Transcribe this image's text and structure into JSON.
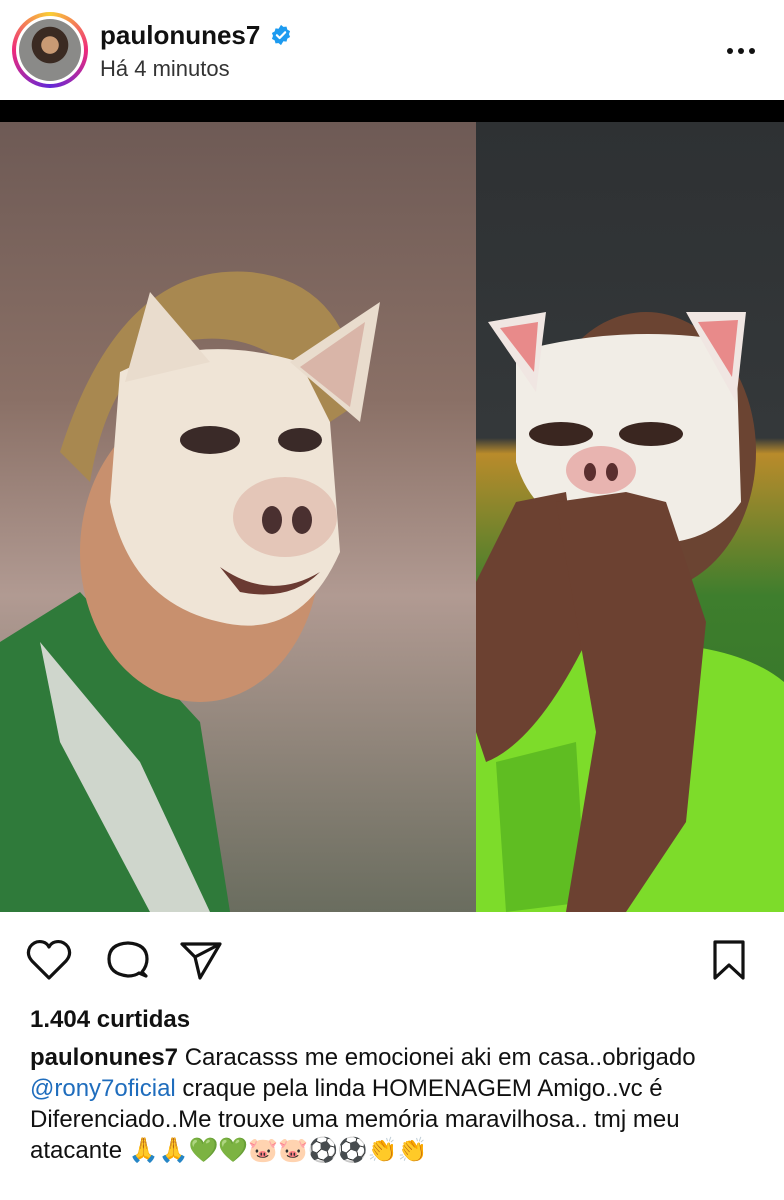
{
  "post": {
    "username": "paulonunes7",
    "timestamp": "Há 4 minutos",
    "verified": true
  },
  "icons": {
    "verified": "verified-badge-icon",
    "more": "more-options-icon",
    "like": "heart-icon",
    "comment": "comment-icon",
    "share": "paper-plane-icon",
    "save": "bookmark-icon"
  },
  "colors": {
    "verified": "#1d9bf0",
    "mention": "#1f6dbd"
  },
  "engagement": {
    "likes": "1.404 curtidas"
  },
  "caption": {
    "username": "paulonunes7",
    "text_before": " Caracasss me emocionei aki em casa..obrigado ",
    "mention": "@rony7oficial",
    "text_after": " craque pela linda HOMENAGEM Amigo..vc é Diferenciado..Me trouxe uma memória maravilhosa.. tmj meu atacante 🙏🙏💚💚🐷🐷⚽⚽👏👏"
  }
}
